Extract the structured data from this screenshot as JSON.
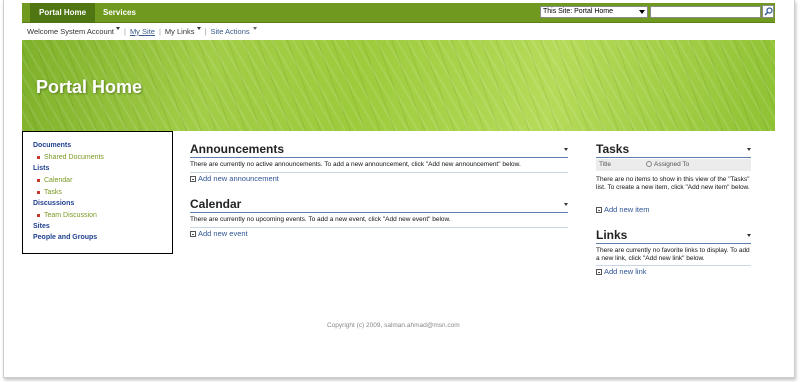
{
  "topbar": {
    "tabs": [
      {
        "label": "Portal Home",
        "active": true
      },
      {
        "label": "Services",
        "active": false
      }
    ],
    "search_scope": "This Site: Portal Home",
    "search_placeholder": ""
  },
  "userbar": {
    "welcome": "Welcome System Account",
    "my_site": "My Site",
    "my_links": "My Links",
    "site_actions": "Site Actions"
  },
  "banner": {
    "title": "Portal Home"
  },
  "quicklaunch": {
    "items": [
      {
        "label": "Documents",
        "type": "head"
      },
      {
        "label": "Shared Documents",
        "type": "sub"
      },
      {
        "label": "Lists",
        "type": "head"
      },
      {
        "label": "Calendar",
        "type": "sub"
      },
      {
        "label": "Tasks",
        "type": "sub"
      },
      {
        "label": "Discussions",
        "type": "head"
      },
      {
        "label": "Team Discussion",
        "type": "sub"
      },
      {
        "label": "Sites",
        "type": "head"
      },
      {
        "label": "People and Groups",
        "type": "head"
      }
    ]
  },
  "announcements": {
    "title": "Announcements",
    "empty_text": "There are currently no active announcements. To add a new announcement, click \"Add new announcement\" below.",
    "add_link": "Add new announcement"
  },
  "calendar": {
    "title": "Calendar",
    "empty_text": "There are currently no upcoming events. To add a new event, click \"Add new event\" below.",
    "add_link": "Add new event"
  },
  "tasks": {
    "title": "Tasks",
    "col_title": "Title",
    "col_assigned": "Assigned To",
    "empty_text": "There are no items to show in this view of the \"Tasks\" list. To create a new item, click \"Add new item\" below.",
    "add_link": "Add new item"
  },
  "links": {
    "title": "Links",
    "empty_text": "There are currently no favorite links to display. To add a new link, click \"Add new link\" below.",
    "add_link": "Add new link"
  },
  "footer": {
    "copyright": "Copyright (c) 2009, salman.ahmad@msn.com"
  },
  "colors": {
    "topbar": "#6f9a1f",
    "topbar_active": "#4f7612",
    "link_blue": "#2f5597",
    "nav_green": "#7a9a22"
  }
}
